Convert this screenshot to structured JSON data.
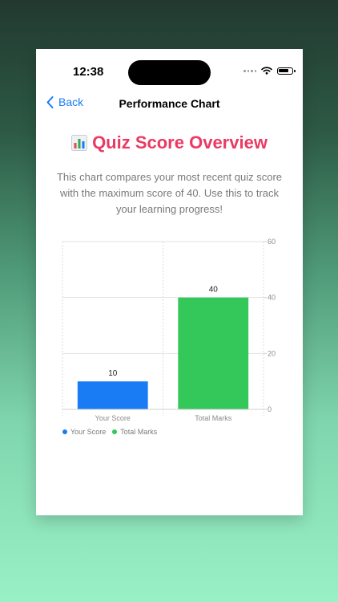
{
  "status": {
    "time": "12:38"
  },
  "nav": {
    "back_label": "Back",
    "title": "Performance Chart"
  },
  "header": {
    "title": "Quiz Score Overview",
    "icon": "bar-chart-icon"
  },
  "description": "This chart compares your most recent quiz score with the maximum score of 40. Use this to track your learning progress!",
  "colors": {
    "accent": "#1a7cf5",
    "heading": "#ea3a63",
    "your_score": "#1a7cf5",
    "total_marks": "#34c759"
  },
  "chart_data": {
    "type": "bar",
    "categories": [
      "Your Score",
      "Total Marks"
    ],
    "values": [
      10,
      40
    ],
    "colors": [
      "#1a7cf5",
      "#34c759"
    ],
    "data_labels": [
      "10",
      "40"
    ],
    "ylim": [
      0,
      60
    ],
    "yticks": [
      0,
      20,
      40,
      60
    ],
    "y_axis_side": "right",
    "grid": true,
    "legend": [
      "Your Score",
      "Total Marks"
    ],
    "legend_placement": "bottom-left"
  }
}
